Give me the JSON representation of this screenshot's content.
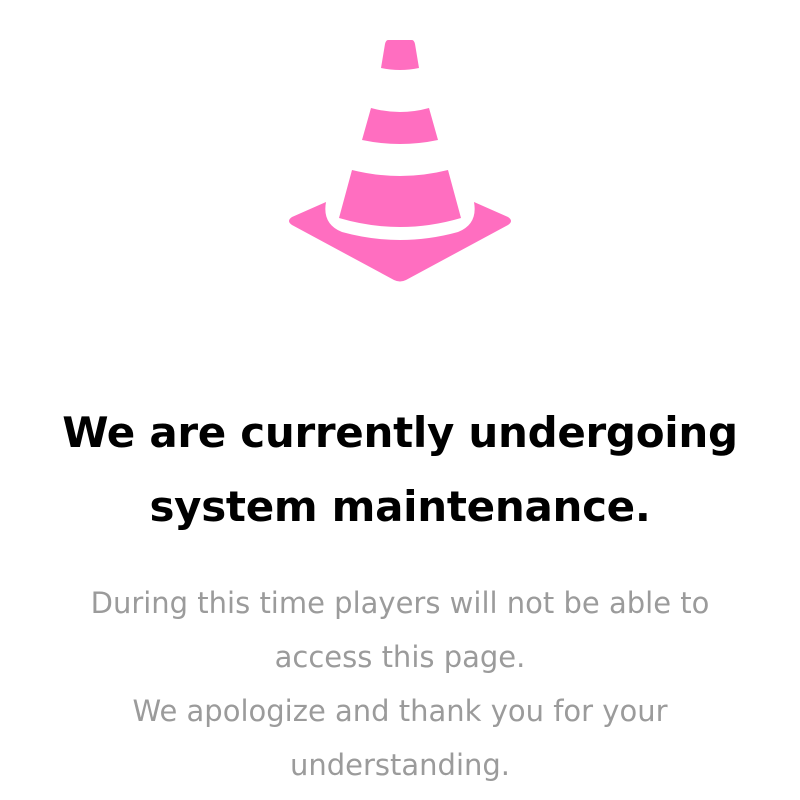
{
  "icon": {
    "name": "traffic-cone-icon",
    "color": "#ff6ec0"
  },
  "headline": {
    "line1": "We are currently undergoing",
    "line2": "system maintenance."
  },
  "message": {
    "line1": "During this time players will not be able to",
    "line2": "access this page.",
    "line3": "We apologize and thank you for your",
    "line4": "understanding."
  },
  "colors": {
    "background": "#ffffff",
    "headline": "#000000",
    "message": "#9b9b9b"
  }
}
